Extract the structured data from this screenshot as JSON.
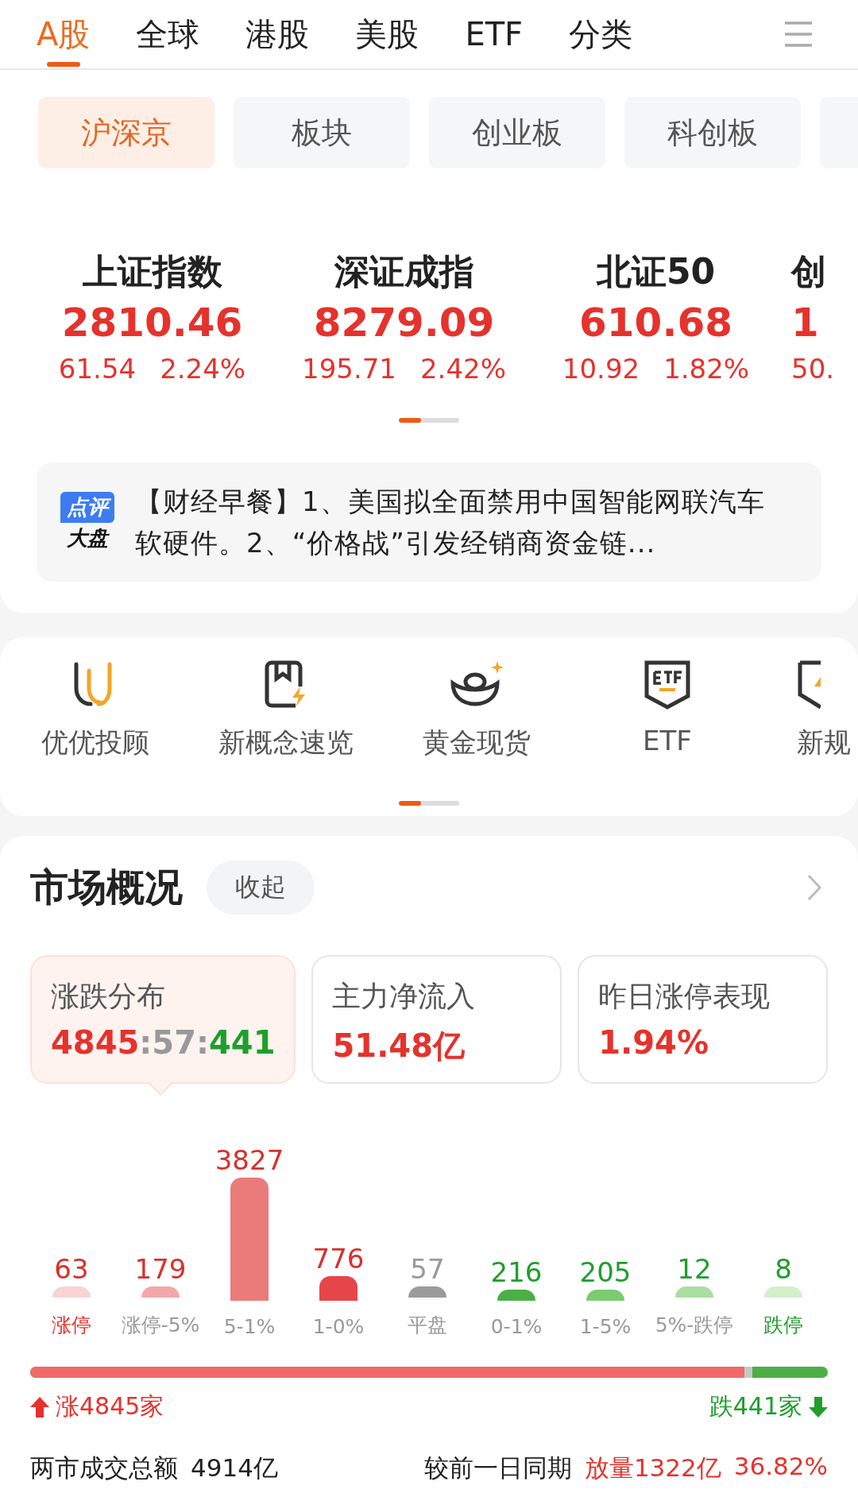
{
  "tabs": [
    {
      "label": "A股",
      "selected": true
    },
    {
      "label": "全球",
      "selected": false
    },
    {
      "label": "港股",
      "selected": false
    },
    {
      "label": "美股",
      "selected": false
    },
    {
      "label": "ETF",
      "selected": false
    },
    {
      "label": "分类",
      "selected": false
    }
  ],
  "subtabs": [
    {
      "label": "沪深京",
      "selected": true
    },
    {
      "label": "板块",
      "selected": false
    },
    {
      "label": "创业板",
      "selected": false
    },
    {
      "label": "科创板",
      "selected": false
    }
  ],
  "indices": [
    {
      "name": "上证指数",
      "value": "2810.46",
      "change": "61.54",
      "percent": "2.24%"
    },
    {
      "name": "深证成指",
      "value": "8279.09",
      "change": "195.71",
      "percent": "2.42%"
    },
    {
      "name": "北证50",
      "value": "610.68",
      "change": "10.92",
      "percent": "1.82%"
    },
    {
      "name": "创",
      "value": "1",
      "change": "50."
    }
  ],
  "news": {
    "badge_top": "点评",
    "badge_bottom": "大盘",
    "text": "【财经早餐】1、美国拟全面禁用中国智能网联汽车软硬件。2、“价格战”引发经销商资金链..."
  },
  "shortcuts": [
    {
      "label": "优优投顾"
    },
    {
      "label": "新概念速览"
    },
    {
      "label": "黄金现货"
    },
    {
      "label": "ETF"
    },
    {
      "label": "新规"
    }
  ],
  "market": {
    "title": "市场概况",
    "collapse": "收起",
    "cards": [
      {
        "label": "涨跌分布",
        "selected": true,
        "parts": [
          {
            "text": "4845",
            "color": "#e5322d"
          },
          {
            "text": ":57:",
            "color": "#999999"
          },
          {
            "text": "441",
            "color": "#1f9e2c"
          }
        ]
      },
      {
        "label": "主力净流入",
        "selected": false,
        "parts": [
          {
            "text": "51.48亿",
            "color": "#e5322d"
          }
        ]
      },
      {
        "label": "昨日涨停表现",
        "selected": false,
        "parts": [
          {
            "text": "1.94%",
            "color": "#e5322d"
          }
        ]
      }
    ],
    "distribution": [
      {
        "label": "涨停",
        "value": "63",
        "kind": "limit_up",
        "color": "#f8d4d4"
      },
      {
        "label": "涨停-5%",
        "value": "179",
        "kind": "up",
        "color": "#f2a8a8"
      },
      {
        "label": "5-1%",
        "value": "3827",
        "kind": "up",
        "color": "#eb7b7b"
      },
      {
        "label": "1-0%",
        "value": "776",
        "kind": "up",
        "color": "#e5464a"
      },
      {
        "label": "平盘",
        "value": "57",
        "kind": "flat",
        "color": "#9b9b9b"
      },
      {
        "label": "0-1%",
        "value": "216",
        "kind": "down",
        "color": "#4caf45"
      },
      {
        "label": "1-5%",
        "value": "205",
        "kind": "down",
        "color": "#7ccb70"
      },
      {
        "label": "5%-跌停",
        "value": "12",
        "kind": "down",
        "color": "#a9dea0"
      },
      {
        "label": "跌停",
        "value": "8",
        "kind": "limit_down",
        "color": "#d3efcc"
      }
    ],
    "breadth": {
      "level": 0.905,
      "up": "涨4845家",
      "down": "跌441家"
    },
    "turnover": {
      "label": "两市成交总额",
      "value": "4914亿",
      "compare_label": "较前一日同期",
      "compare_value": "放量1322亿",
      "compare_percent": "36.82%"
    }
  }
}
